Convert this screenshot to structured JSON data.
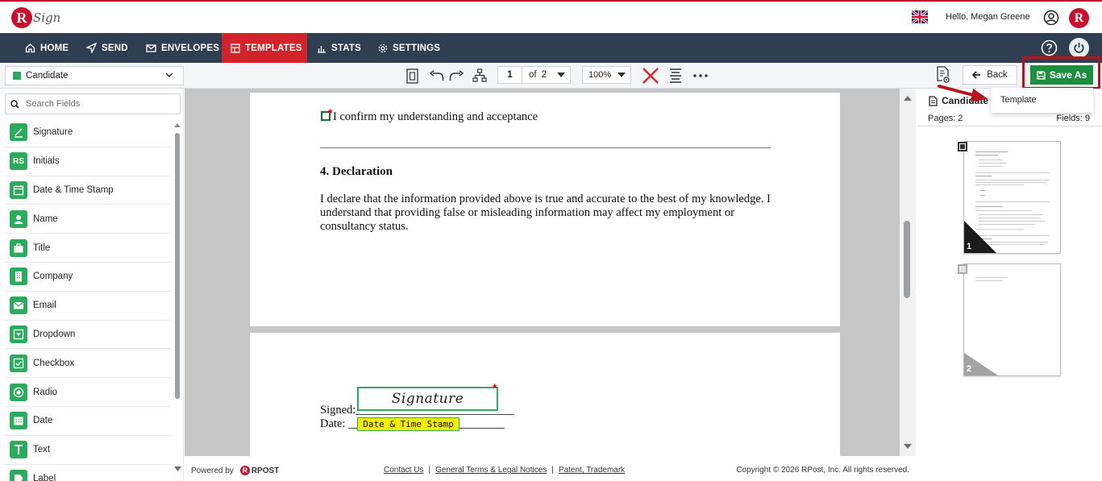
{
  "header": {
    "logo_letter": "R",
    "logo_text": "Sign",
    "greeting": "Hello, Megan Greene",
    "brand_badge": "R"
  },
  "nav": {
    "items": [
      {
        "label": "HOME",
        "icon": "home-icon"
      },
      {
        "label": "SEND",
        "icon": "send-icon"
      },
      {
        "label": "ENVELOPES",
        "icon": "envelope-icon"
      },
      {
        "label": "TEMPLATES",
        "icon": "templates-icon",
        "active": true
      },
      {
        "label": "STATS",
        "icon": "stats-icon"
      },
      {
        "label": "SETTINGS",
        "icon": "gear-icon"
      }
    ],
    "active_color": "#d2232a",
    "background": "#2f3e51"
  },
  "toolbar": {
    "recipient": "Candidate",
    "recipient_color": "#2daa5e",
    "page_current": "1",
    "page_of": "of",
    "page_total": "2",
    "zoom": "100%",
    "back_label": "Back",
    "save_as_label": "Save As",
    "save_color": "#1d8e3d"
  },
  "dropdown": {
    "items": [
      "Template"
    ]
  },
  "sidebar": {
    "search_placeholder": "Search Fields",
    "fields": [
      {
        "label": "Signature",
        "icon": "signature-icon"
      },
      {
        "label": "Initials",
        "icon": "initials-icon"
      },
      {
        "label": "Date & Time Stamp",
        "icon": "date-time-icon"
      },
      {
        "label": "Name",
        "icon": "name-icon"
      },
      {
        "label": "Title",
        "icon": "title-icon"
      },
      {
        "label": "Company",
        "icon": "company-icon"
      },
      {
        "label": "Email",
        "icon": "email-icon"
      },
      {
        "label": "Dropdown",
        "icon": "dropdown-icon"
      },
      {
        "label": "Checkbox",
        "icon": "checkbox-icon"
      },
      {
        "label": "Radio",
        "icon": "radio-icon"
      },
      {
        "label": "Date",
        "icon": "calendar-icon"
      },
      {
        "label": "Text",
        "icon": "text-icon"
      },
      {
        "label": "Label",
        "icon": "label-icon"
      }
    ]
  },
  "document": {
    "confirm_text": "I confirm my understanding and acceptance",
    "section_heading": "4. Declaration",
    "declaration_text": "I declare that the information provided above is true and accurate to the best of my knowledge. I understand that providing false or misleading information may affect my employment or consultancy status.",
    "signed_label": "Signed:",
    "date_label": "Date:",
    "signature_field": "Signature",
    "date_field": "Date & Time Stamp",
    "required_mark": "*"
  },
  "right_panel": {
    "recipient": "Candidate",
    "pages_label": "Pages: 2",
    "fields_label": "Fields: 9",
    "thumbnails": [
      {
        "number": "1"
      },
      {
        "number": "2"
      }
    ]
  },
  "footer": {
    "powered_by": "Powered by",
    "rpost_letter": "R",
    "rpost_text": "RPOST",
    "contact": "Contact Us",
    "terms": "General Terms & Legal Notices",
    "patent": "Patent, Trademark",
    "separator": "|",
    "copyright": "Copyright © 2026 RPost, Inc. All rights reserved."
  }
}
